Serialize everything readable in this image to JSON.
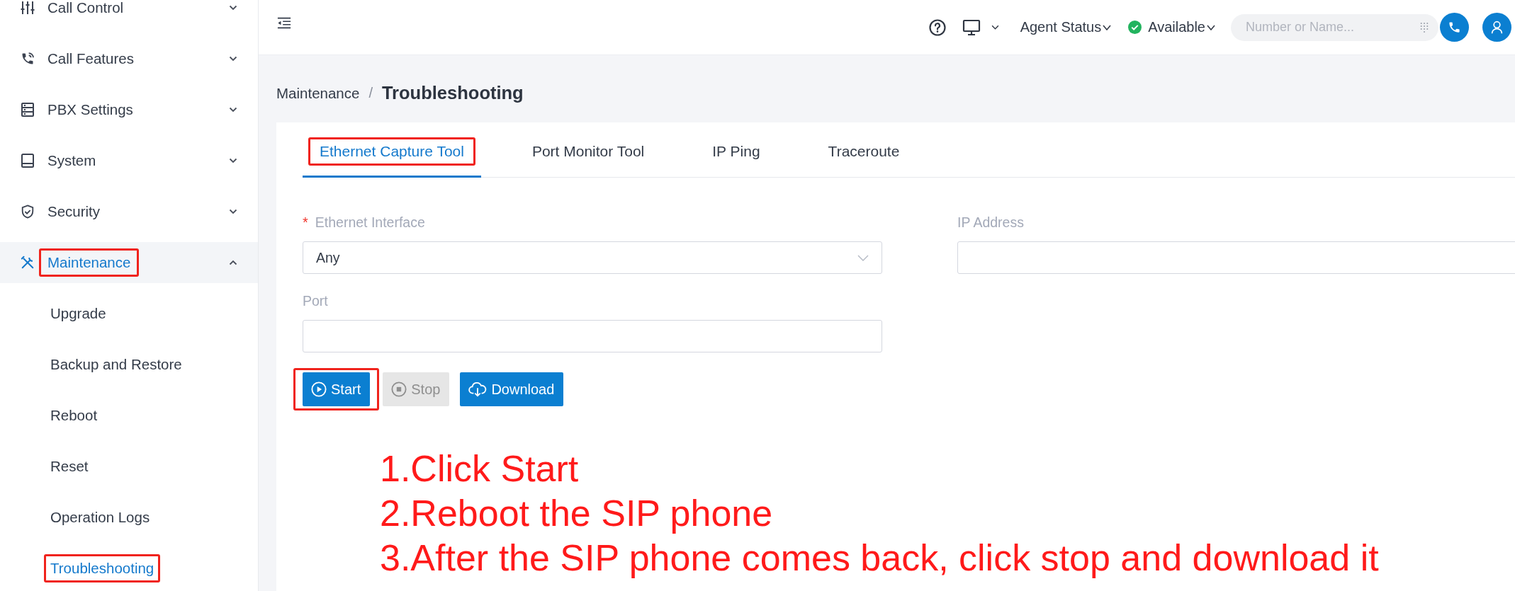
{
  "sidebar": {
    "items": [
      {
        "label": "Call Control",
        "selected": false,
        "expanded": false,
        "highlighted": false
      },
      {
        "label": "Call Features",
        "selected": false,
        "expanded": false,
        "highlighted": false
      },
      {
        "label": "PBX Settings",
        "selected": false,
        "expanded": false,
        "highlighted": false
      },
      {
        "label": "System",
        "selected": false,
        "expanded": false,
        "highlighted": false
      },
      {
        "label": "Security",
        "selected": false,
        "expanded": false,
        "highlighted": false
      },
      {
        "label": "Maintenance",
        "selected": true,
        "expanded": true,
        "highlighted": true,
        "children": [
          {
            "label": "Upgrade",
            "selected": false,
            "highlighted": false
          },
          {
            "label": "Backup and Restore",
            "selected": false,
            "highlighted": false
          },
          {
            "label": "Reboot",
            "selected": false,
            "highlighted": false
          },
          {
            "label": "Reset",
            "selected": false,
            "highlighted": false
          },
          {
            "label": "Operation Logs",
            "selected": false,
            "highlighted": false
          },
          {
            "label": "Troubleshooting",
            "selected": true,
            "highlighted": true
          }
        ]
      }
    ]
  },
  "topbar": {
    "agent_status": {
      "label": "Agent Status"
    },
    "availability": {
      "label": "Available"
    },
    "search": {
      "placeholder": "Number or Name..."
    }
  },
  "breadcrumb": {
    "items": [
      {
        "label": "Maintenance"
      },
      {
        "label": "Troubleshooting"
      }
    ],
    "separator": "/"
  },
  "tabs": [
    {
      "label": "Ethernet Capture Tool",
      "selected": true,
      "highlighted": true
    },
    {
      "label": "Port Monitor Tool",
      "selected": false,
      "highlighted": false
    },
    {
      "label": "IP Ping",
      "selected": false,
      "highlighted": false
    },
    {
      "label": "Traceroute",
      "selected": false,
      "highlighted": false
    }
  ],
  "form": {
    "fields": [
      {
        "label": "Ethernet Interface",
        "kind": "select",
        "required_mark": "*",
        "value": "Any"
      },
      {
        "label": "IP Address",
        "kind": "input"
      },
      {
        "label": "Port",
        "kind": "input"
      }
    ]
  },
  "buttons": [
    {
      "label": "Start",
      "disabled": false,
      "highlighted": true
    },
    {
      "label": "Stop",
      "disabled": true,
      "highlighted": false
    },
    {
      "label": "Download",
      "disabled": false,
      "highlighted": false
    }
  ],
  "annotation": {
    "lines": [
      "1.Click Start",
      "2.Reboot the SIP phone",
      "3.After the SIP phone comes back, click stop and download it"
    ]
  }
}
